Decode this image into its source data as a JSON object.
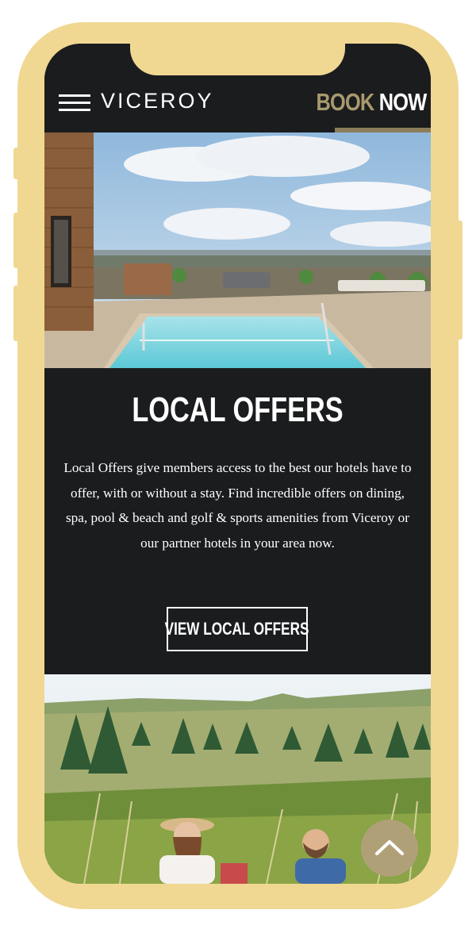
{
  "header": {
    "logo": "VICEROY",
    "book_now_part1": "BOOK",
    "book_now_part2": "NOW",
    "menu_icon": "hamburger-menu-icon"
  },
  "offers": {
    "title": "LOCAL OFFERS",
    "description": "Local Offers give members access to the best our hotels have to offer, with or without a stay. Find incredible offers on dining, spa, pool & beach and golf & sports amenities from Viceroy or our partner hotels in your area now.",
    "button_label": "VIEW LOCAL OFFERS"
  },
  "scroll_top_icon": "chevron-up-icon",
  "colors": {
    "frame": "#f0d893",
    "background": "#1b1c1e",
    "accent_gold": "#a89a6e",
    "scroll_button": "#b0a078"
  }
}
